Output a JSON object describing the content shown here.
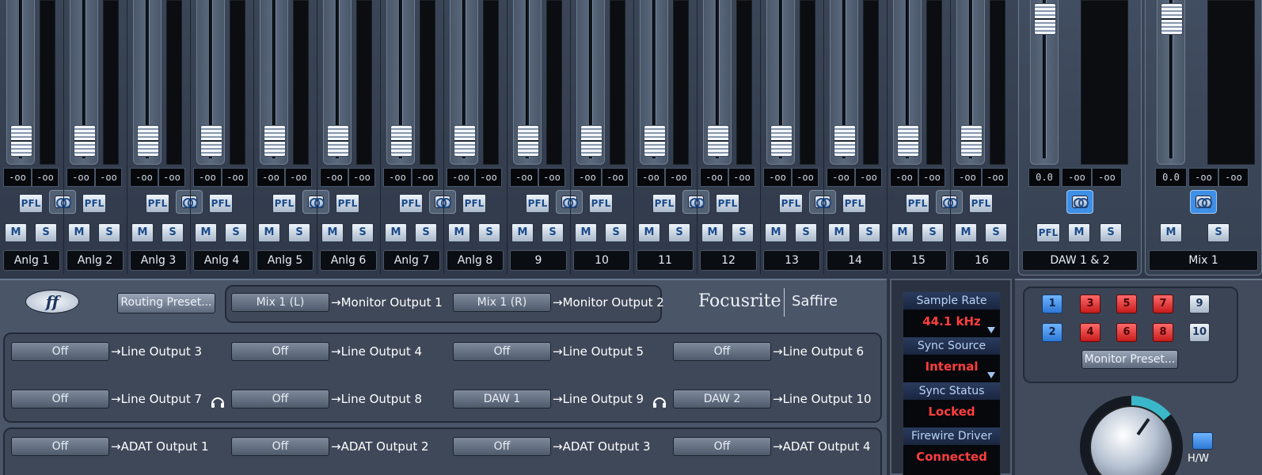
{
  "app": {
    "brand": "Focusrite",
    "product": "Saffire"
  },
  "channels": [
    {
      "name": "Anlg 1",
      "level_l": "-oo",
      "level_r": "-oo",
      "pfl": "PFL",
      "mute": "M",
      "solo": "S"
    },
    {
      "name": "Anlg 2",
      "level_l": "-oo",
      "level_r": "-oo",
      "pfl": "PFL",
      "mute": "M",
      "solo": "S"
    },
    {
      "name": "Anlg 3",
      "level_l": "-oo",
      "level_r": "-oo",
      "pfl": "PFL",
      "mute": "M",
      "solo": "S"
    },
    {
      "name": "Anlg 4",
      "level_l": "-oo",
      "level_r": "-oo",
      "pfl": "PFL",
      "mute": "M",
      "solo": "S"
    },
    {
      "name": "Anlg 5",
      "level_l": "-oo",
      "level_r": "-oo",
      "pfl": "PFL",
      "mute": "M",
      "solo": "S"
    },
    {
      "name": "Anlg 6",
      "level_l": "-oo",
      "level_r": "-oo",
      "pfl": "PFL",
      "mute": "M",
      "solo": "S"
    },
    {
      "name": "Anlg 7",
      "level_l": "-oo",
      "level_r": "-oo",
      "pfl": "PFL",
      "mute": "M",
      "solo": "S"
    },
    {
      "name": "Anlg 8",
      "level_l": "-oo",
      "level_r": "-oo",
      "pfl": "PFL",
      "mute": "M",
      "solo": "S"
    },
    {
      "name": "9",
      "level_l": "-oo",
      "level_r": "-oo",
      "pfl": "PFL",
      "mute": "M",
      "solo": "S"
    },
    {
      "name": "10",
      "level_l": "-oo",
      "level_r": "-oo",
      "pfl": "PFL",
      "mute": "M",
      "solo": "S"
    },
    {
      "name": "11",
      "level_l": "-oo",
      "level_r": "-oo",
      "pfl": "PFL",
      "mute": "M",
      "solo": "S"
    },
    {
      "name": "12",
      "level_l": "-oo",
      "level_r": "-oo",
      "pfl": "PFL",
      "mute": "M",
      "solo": "S"
    },
    {
      "name": "13",
      "level_l": "-oo",
      "level_r": "-oo",
      "pfl": "PFL",
      "mute": "M",
      "solo": "S"
    },
    {
      "name": "14",
      "level_l": "-oo",
      "level_r": "-oo",
      "pfl": "PFL",
      "mute": "M",
      "solo": "S"
    },
    {
      "name": "15",
      "level_l": "-oo",
      "level_r": "-oo",
      "pfl": "PFL",
      "mute": "M",
      "solo": "S"
    },
    {
      "name": "16",
      "level_l": "-oo",
      "level_r": "-oo",
      "pfl": "PFL",
      "mute": "M",
      "solo": "S"
    }
  ],
  "daw_strip": {
    "name": "DAW 1 & 2",
    "gain": "0.0",
    "level_l": "-oo",
    "level_r": "-oo",
    "pfl": "PFL",
    "mute": "M",
    "solo": "S"
  },
  "mix_strip": {
    "name": "Mix 1",
    "gain": "0.0",
    "level_l": "-oo",
    "level_r": "-oo",
    "mute": "M",
    "solo": "S"
  },
  "routing": {
    "preset_button": "Routing Preset...",
    "monitor_routes": [
      {
        "source": "Mix 1 (L)",
        "dest": "→Monitor Output 1"
      },
      {
        "source": "Mix 1 (R)",
        "dest": "→Monitor Output 2"
      }
    ],
    "line_routes": [
      {
        "source": "Off",
        "dest": "→Line Output 3"
      },
      {
        "source": "Off",
        "dest": "→Line Output 4"
      },
      {
        "source": "Off",
        "dest": "→Line Output 5"
      },
      {
        "source": "Off",
        "dest": "→Line Output 6"
      },
      {
        "source": "Off",
        "dest": "→Line Output 7"
      },
      {
        "source": "Off",
        "dest": "→Line Output 8"
      },
      {
        "source": "DAW 1",
        "dest": "→Line Output 9"
      },
      {
        "source": "DAW 2",
        "dest": "→Line Output 10"
      }
    ],
    "adat_routes": [
      {
        "source": "Off",
        "dest": "→ADAT Output 1"
      },
      {
        "source": "Off",
        "dest": "→ADAT Output 2"
      },
      {
        "source": "Off",
        "dest": "→ADAT Output 3"
      },
      {
        "source": "Off",
        "dest": "→ADAT Output 4"
      }
    ]
  },
  "status": {
    "sample_rate": {
      "title": "Sample Rate",
      "value": "44.1 kHz"
    },
    "sync_source": {
      "title": "Sync Source",
      "value": "Internal"
    },
    "sync_status": {
      "title": "Sync Status",
      "value": "Locked"
    },
    "firewire_driver": {
      "title": "Firewire Driver",
      "value": "Connected"
    }
  },
  "monitor": {
    "buttons": [
      "1",
      "2",
      "3",
      "4",
      "5",
      "6",
      "7",
      "8",
      "9",
      "10"
    ],
    "preset_button": "Monitor Preset...",
    "hw_label": "H/W"
  },
  "colors": {
    "accent_blue": "#3e8fe6",
    "status_red": "#ff3e3e",
    "panel": "#4b5568"
  }
}
